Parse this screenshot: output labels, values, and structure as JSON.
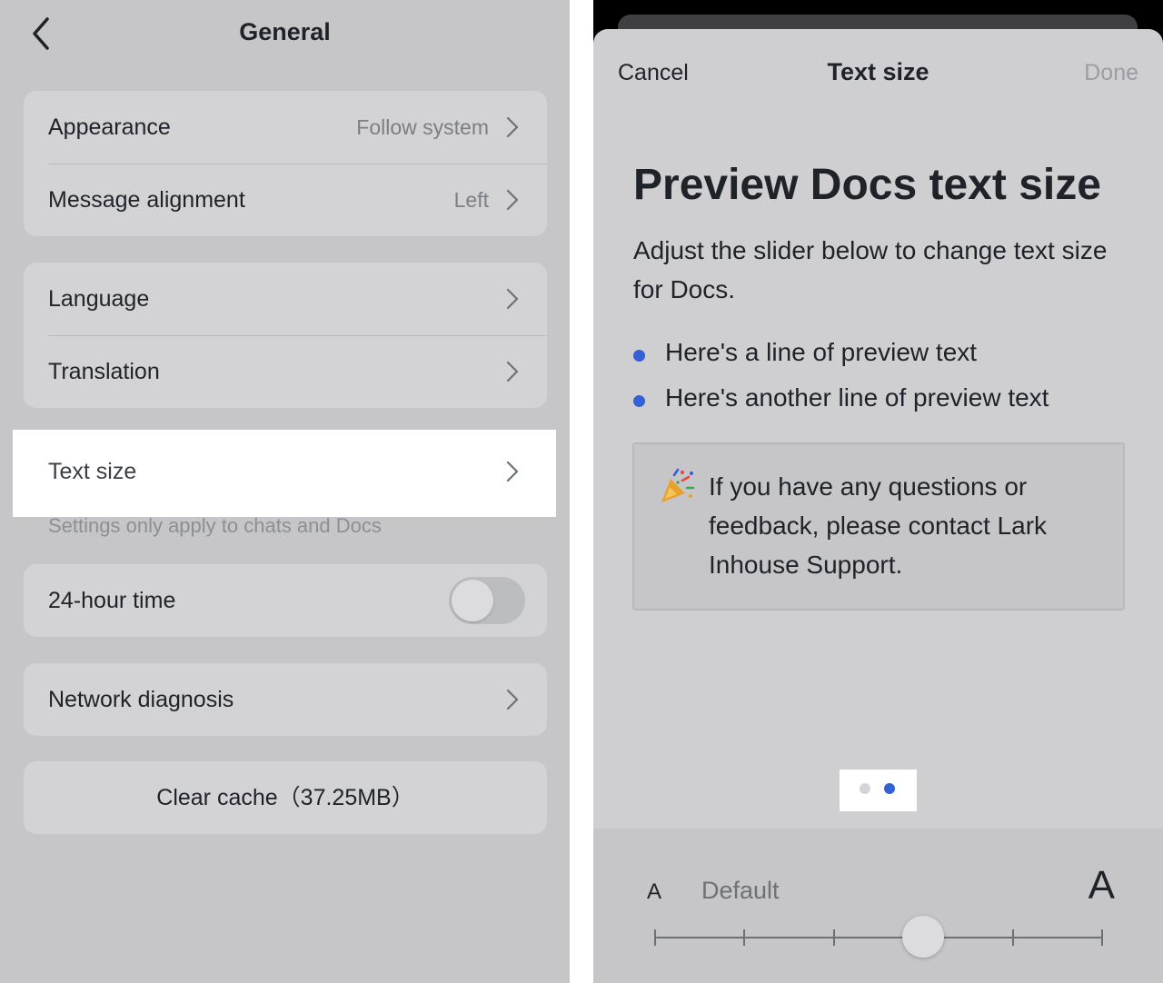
{
  "left": {
    "title": "General",
    "group1": [
      {
        "label": "Appearance",
        "value": "Follow system"
      },
      {
        "label": "Message alignment",
        "value": "Left"
      }
    ],
    "group2": [
      {
        "label": "Language"
      },
      {
        "label": "Translation"
      }
    ],
    "text_size_label": "Text size",
    "hint": "Settings only apply to chats and Docs",
    "time_label": "24-hour time",
    "time_enabled": false,
    "network_label": "Network diagnosis",
    "clear_cache_label": "Clear cache（37.25MB）"
  },
  "right": {
    "nav": {
      "cancel": "Cancel",
      "title": "Text size",
      "done": "Done"
    },
    "preview_title": "Preview Docs text size",
    "preview_desc": "Adjust the slider below to change text size for Docs.",
    "bullets": [
      "Here's a line of preview text",
      "Here's another line of preview text"
    ],
    "callout_icon": "party-popper-icon",
    "callout_text": "If you have any questions or feedback, please contact Lark Inhouse Support.",
    "pager": {
      "count": 2,
      "active_index": 1
    },
    "slider": {
      "small_label": "A",
      "current_label": "Default",
      "large_label": "A",
      "steps": 6,
      "value_index": 3
    }
  },
  "colors": {
    "accent_blue": "#3461d7",
    "panel_gray": "#c6c6c8",
    "card_gray": "#d3d3d5",
    "sheet_gray": "#cfcfd1"
  }
}
